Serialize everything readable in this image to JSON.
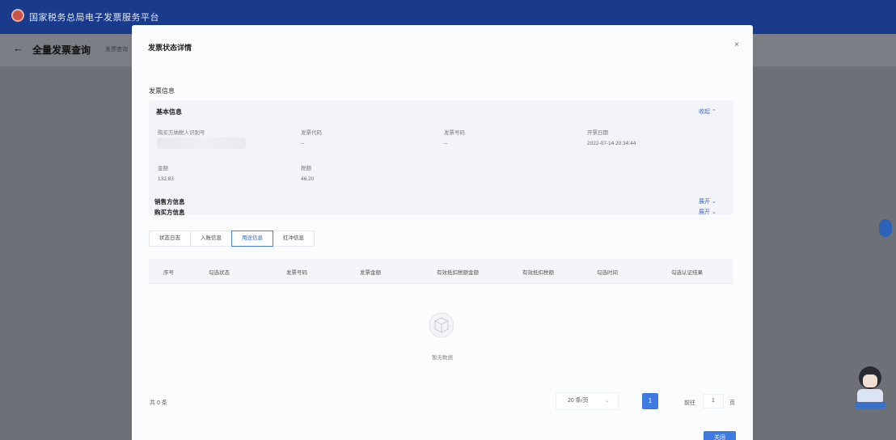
{
  "app": {
    "title": "国家税务总局电子发票服务平台",
    "page_title": "全量发票查询",
    "page_sub": "发票查询"
  },
  "modal": {
    "title": "发票状态详情",
    "close_icon": "×",
    "section_title": "发票信息",
    "basic_title": "基本信息",
    "collapse_label": "收起 ⌃",
    "fields": [
      {
        "label": "购买方纳税人识别号",
        "value": ""
      },
      {
        "label": "发票代码",
        "value": "--"
      },
      {
        "label": "发票号码",
        "value": "--"
      },
      {
        "label": "开票日期",
        "value": "2022-07-14 20:34:44"
      },
      {
        "label": "金额",
        "value": "132.83"
      },
      {
        "label": "税额",
        "value": "46.20"
      }
    ],
    "seller_title": "销售方信息",
    "buyer_title": "购买方信息",
    "expand_label": "展开 ⌄",
    "tabs": [
      "状态日志",
      "入账信息",
      "用途信息",
      "红冲信息"
    ],
    "active_tab": 2,
    "table_headers": [
      "序号",
      "勾选状态",
      "发票号码",
      "发票金额",
      "有效抵扣税额金额",
      "有效抵扣税额",
      "勾选时间",
      "勾选认证结果"
    ],
    "empty_text": "暂无数据",
    "total_text": "共 0 条",
    "page_size": "20 条/页",
    "page_size_caret": "⌄",
    "current_page": "1",
    "goto_label": "前往",
    "goto_value": "1",
    "goto_suffix": "页",
    "close_button": "关闭"
  }
}
